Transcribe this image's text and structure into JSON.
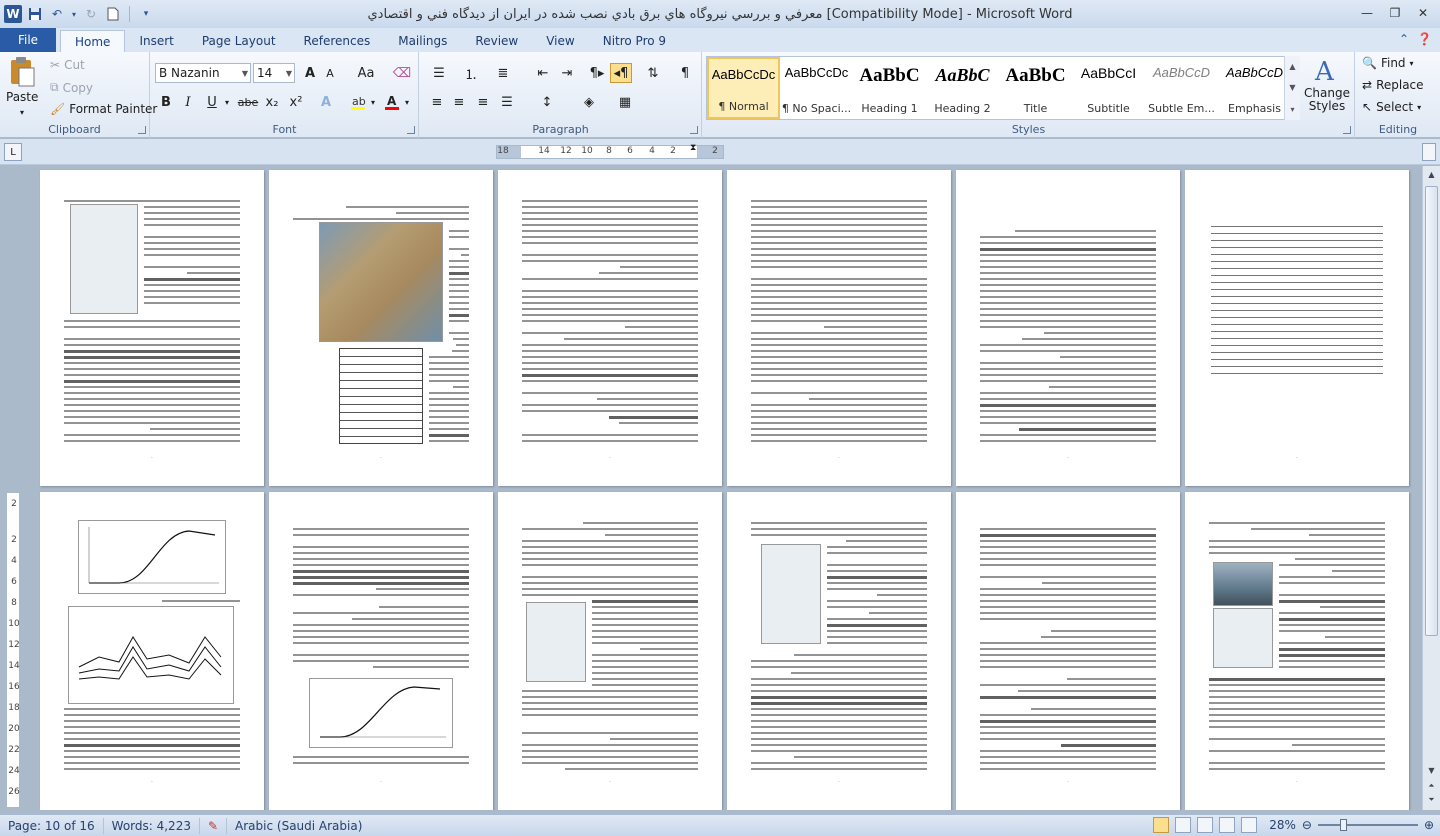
{
  "window": {
    "title": "معرفي و بررسي نيروگاه هاي برق بادي نصب شده در ايران از ديدگاه فني و اقتصادي [Compatibility Mode] - Microsoft Word"
  },
  "qat": {
    "app_icon": "W"
  },
  "tabs": [
    {
      "label": "File"
    },
    {
      "label": "Home"
    },
    {
      "label": "Insert"
    },
    {
      "label": "Page Layout"
    },
    {
      "label": "References"
    },
    {
      "label": "Mailings"
    },
    {
      "label": "Review"
    },
    {
      "label": "View"
    },
    {
      "label": "Nitro Pro 9"
    }
  ],
  "clipboard": {
    "group_label": "Clipboard",
    "paste": "Paste",
    "cut": "Cut",
    "copy": "Copy",
    "format_painter": "Format Painter"
  },
  "font": {
    "group_label": "Font",
    "font_name": "B Nazanin",
    "font_size": "14",
    "bold": "B",
    "italic": "I",
    "underline": "U",
    "strike": "abe",
    "subscript": "x₂",
    "superscript": "x²",
    "grow": "A",
    "shrink": "A",
    "change_case": "Aa",
    "highlight_color": "#ffff00",
    "font_color": "#ff0000"
  },
  "paragraph": {
    "group_label": "Paragraph"
  },
  "styles": {
    "group_label": "Styles",
    "items": [
      {
        "preview": "AaBbCcDc",
        "name": "¶ Normal"
      },
      {
        "preview": "AaBbCcDc",
        "name": "¶ No Spaci..."
      },
      {
        "preview": "AaBbC",
        "name": "Heading 1"
      },
      {
        "preview": "AaBbC",
        "name": "Heading 2"
      },
      {
        "preview": "AaBbC",
        "name": "Title"
      },
      {
        "preview": "AaBbCcI",
        "name": "Subtitle"
      },
      {
        "preview": "AaBbCcD",
        "name": "Subtle Em..."
      },
      {
        "preview": "AaBbCcD",
        "name": "Emphasis"
      }
    ],
    "change_styles": "Change Styles"
  },
  "editing": {
    "group_label": "Editing",
    "find": "Find",
    "replace": "Replace",
    "select": "Select"
  },
  "ruler": {
    "marks": [
      "18",
      "14",
      "12",
      "10",
      "8",
      "6",
      "4",
      "2",
      "2"
    ]
  },
  "vruler": {
    "marks": [
      "2",
      "2",
      "4",
      "6",
      "8",
      "10",
      "12",
      "14",
      "16",
      "18",
      "20",
      "22",
      "24",
      "26"
    ]
  },
  "status": {
    "page": "Page: 10 of 16",
    "words": "Words: 4,223",
    "language": "Arabic (Saudi Arabia)",
    "zoom": "28%"
  }
}
